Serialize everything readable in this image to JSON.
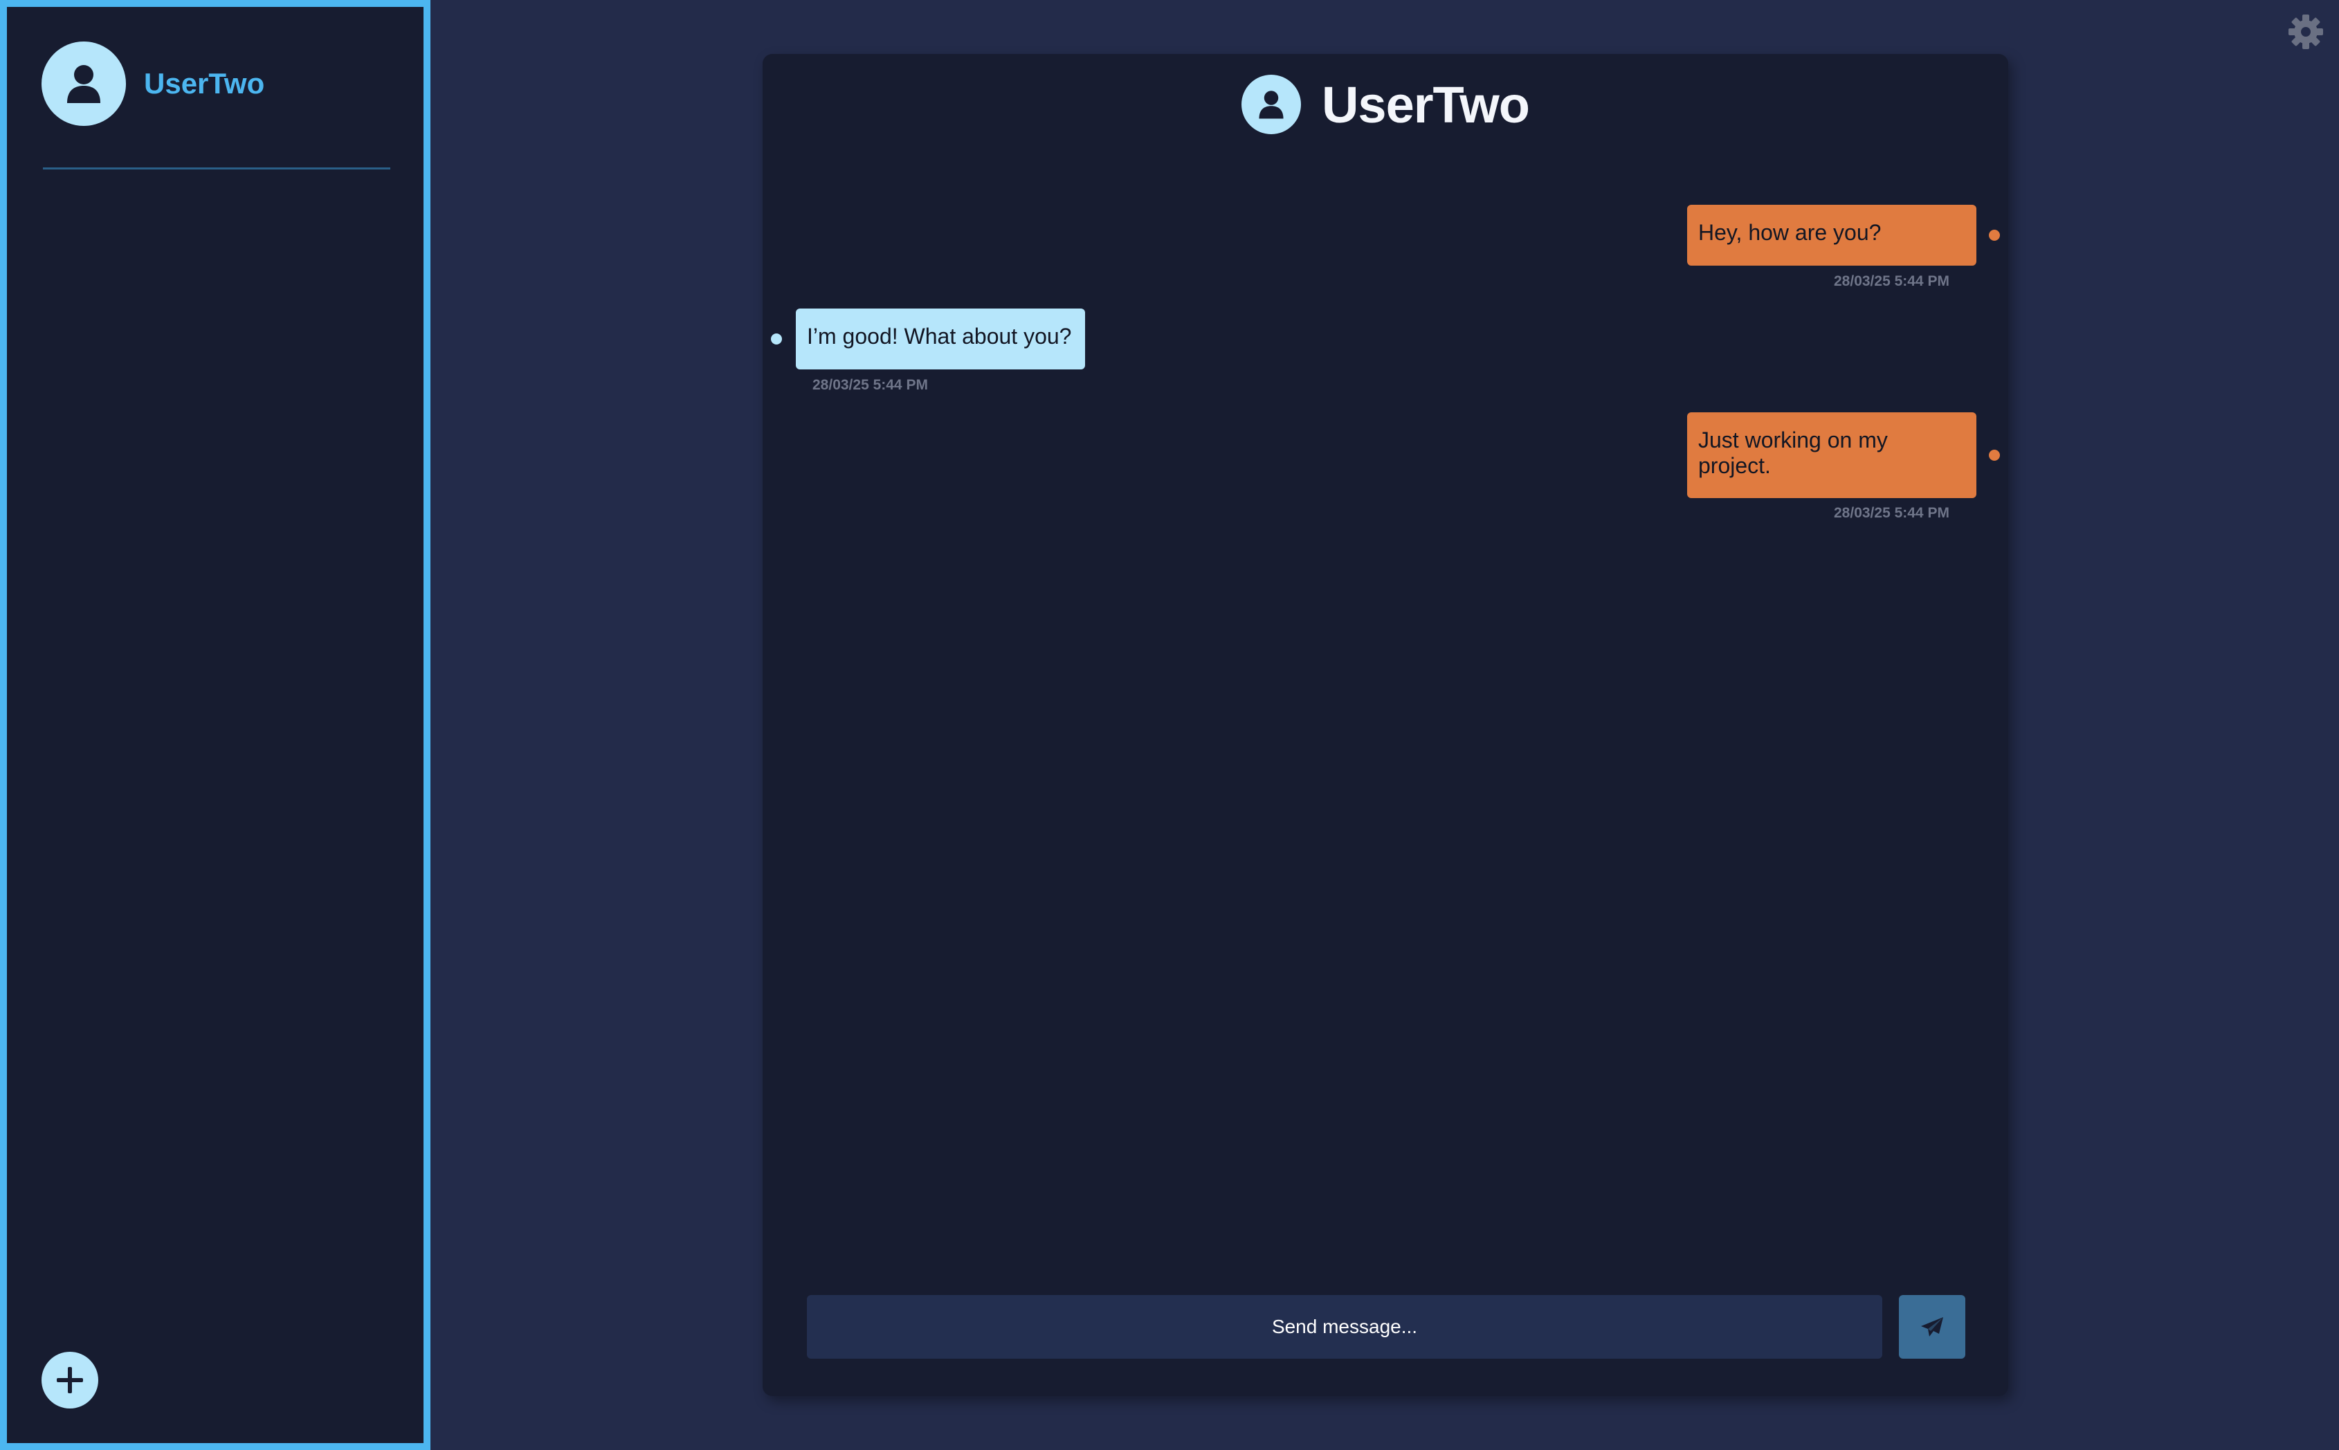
{
  "sidebar": {
    "user_name": "UserTwo",
    "avatar_icon": "user-icon",
    "add_icon": "plus-icon"
  },
  "settings": {
    "icon": "gear-icon"
  },
  "chat": {
    "title": "UserTwo",
    "messages": [
      {
        "direction": "sent",
        "text": "Hey, how are you?",
        "timestamp": "28/03/25 5:44 PM"
      },
      {
        "direction": "received",
        "text": "I’m good! What about you?",
        "timestamp": "28/03/25 5:44 PM"
      },
      {
        "direction": "sent",
        "text": "Just working on my project.",
        "timestamp": "28/03/25 5:44 PM"
      }
    ],
    "input_placeholder": "Send message...",
    "send_icon": "paper-plane-icon"
  },
  "colors": {
    "background": "#232b4a",
    "panel": "#171c30",
    "accent_blue": "#4cb6f0",
    "sent_bubble": "#e07b40",
    "received_bubble": "#b6e6fb",
    "send_button": "#3a6d96"
  }
}
